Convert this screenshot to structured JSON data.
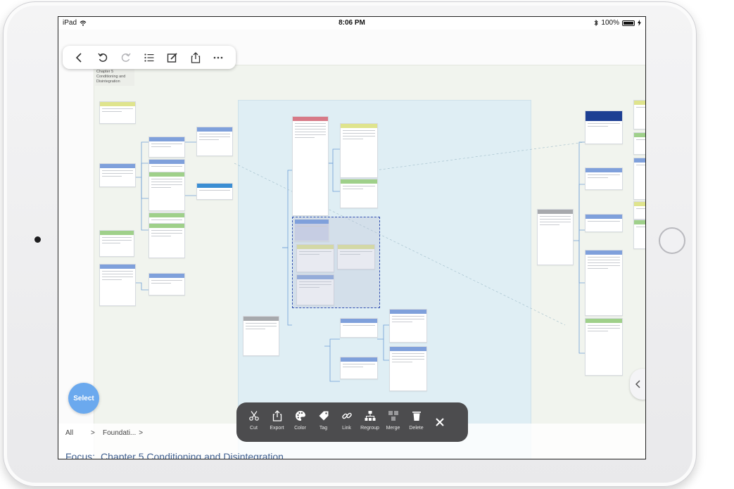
{
  "status_bar": {
    "device": "iPad",
    "time": "8:06 PM",
    "battery": "100%"
  },
  "toolbar": {
    "items": [
      {
        "icon": "back-chevron-icon"
      },
      {
        "icon": "undo-icon"
      },
      {
        "icon": "redo-icon"
      },
      {
        "icon": "outline-list-icon"
      },
      {
        "icon": "edit-icon"
      },
      {
        "icon": "share-icon"
      },
      {
        "icon": "more-icon"
      }
    ]
  },
  "canvas": {
    "chapter_title": "Chapter 5 Conditioning and Disintegration",
    "colors": {
      "region_outer": "#f1f4ee",
      "region_blue": "#dfeef4",
      "selection": "#2f4db0"
    }
  },
  "select_button": {
    "label": "Select"
  },
  "breadcrumb": {
    "root": "All",
    "separator": ">",
    "item": "Foundati...",
    "trailing": ">"
  },
  "focus": {
    "label": "Focus:",
    "value": "Chapter 5 Conditioning and Disintegration"
  },
  "action_bar": {
    "items": [
      {
        "label": "Cut",
        "icon": "scissors-icon"
      },
      {
        "label": "Export",
        "icon": "export-icon"
      },
      {
        "label": "Color",
        "icon": "palette-icon"
      },
      {
        "label": "Tag",
        "icon": "tag-icon"
      },
      {
        "label": "Link",
        "icon": "link-icon"
      },
      {
        "label": "Regroup",
        "icon": "regroup-icon"
      },
      {
        "label": "Merge",
        "icon": "merge-icon"
      },
      {
        "label": "Delete",
        "icon": "trash-icon"
      }
    ],
    "close_icon": "close-icon"
  }
}
